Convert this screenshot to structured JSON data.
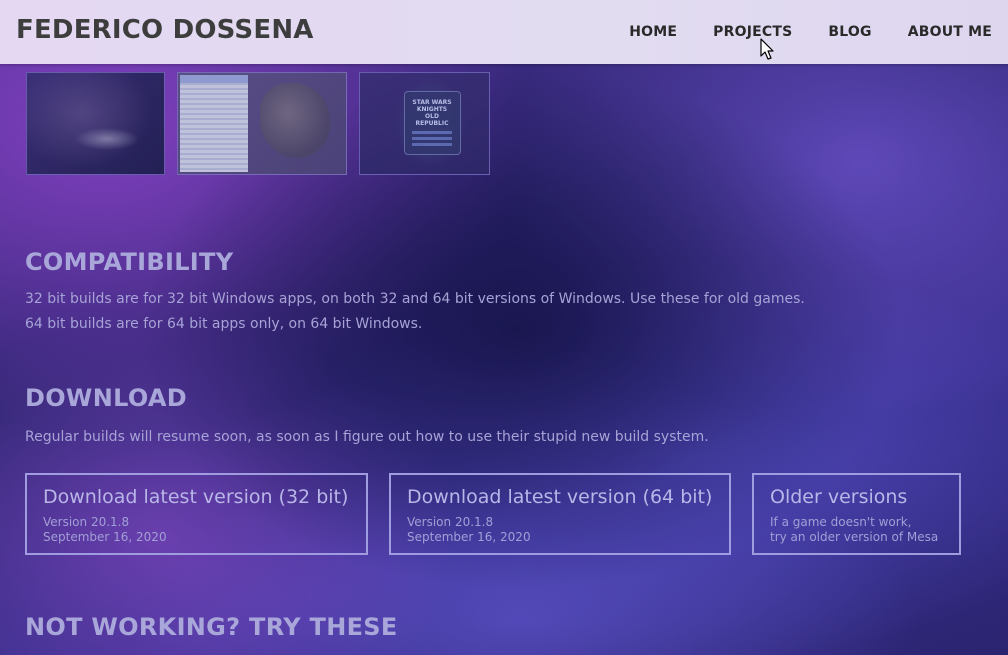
{
  "header": {
    "title": "FEDERICO DOSSENA",
    "nav": {
      "home": "HOME",
      "projects": "PROJECTS",
      "blog": "BLOG",
      "about": "ABOUT ME"
    }
  },
  "screenshots": {
    "third_logo_lines": [
      "STAR WARS",
      "KNIGHTS",
      "OLD REPUBLIC"
    ]
  },
  "compatibility": {
    "heading": "COMPATIBILITY",
    "line1": "32 bit builds are for 32 bit Windows apps, on both 32 and 64 bit versions of Windows. Use these for old games.",
    "line2": "64 bit builds are for 64 bit apps only, on 64 bit Windows."
  },
  "download": {
    "heading": "DOWNLOAD",
    "note": "Regular builds will resume soon, as soon as I figure out how to use their stupid new build system.",
    "buttons": [
      {
        "title": "Download latest version (32 bit)",
        "line1": "Version 20.1.8",
        "line2": "September 16, 2020"
      },
      {
        "title": "Download latest version (64 bit)",
        "line1": "Version 20.1.8",
        "line2": "September 16, 2020"
      },
      {
        "title": "Older versions",
        "line1": "If a game doesn't work,",
        "line2": "try an older version of Mesa"
      }
    ]
  },
  "not_working": {
    "heading": "NOT WORKING? TRY THESE"
  },
  "colors": {
    "header_bg": "#e2dcf1",
    "heading": "#a9a6d9",
    "body_text": "#a7a3d6",
    "button_border": "#9f9ce0"
  },
  "icons": {
    "cursor": "mouse-pointer-icon"
  }
}
